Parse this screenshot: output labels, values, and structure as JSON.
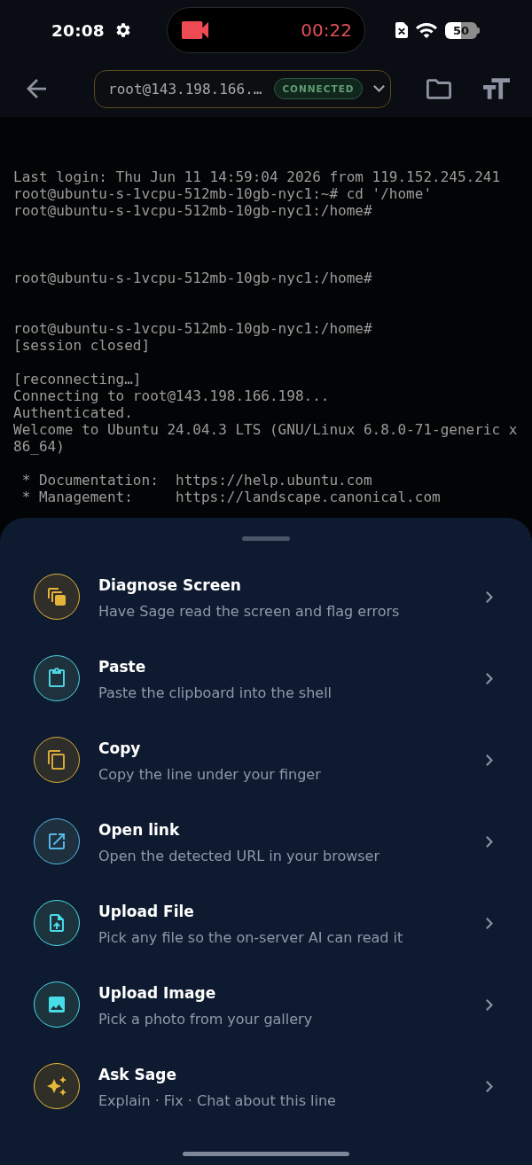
{
  "status_bar": {
    "time": "20:08",
    "recording_timer": "00:22",
    "battery": "50"
  },
  "header": {
    "host": "root@143.198.166.…",
    "status": "CONNECTED"
  },
  "terminal": {
    "lines": [
      {
        "kind": "text",
        "text": "Last login: Thu Jun 11 14:59:04 2026 from 119.152.245.241"
      },
      {
        "kind": "text",
        "text": "root@ubuntu-s-1vcpu-512mb-10gb-nyc1:~# cd '/home'"
      },
      {
        "kind": "text",
        "text": "root@ubuntu-s-1vcpu-512mb-10gb-nyc1:/home#"
      },
      {
        "kind": "blank"
      },
      {
        "kind": "blank"
      },
      {
        "kind": "blank"
      },
      {
        "kind": "text",
        "text": "root@ubuntu-s-1vcpu-512mb-10gb-nyc1:/home#"
      },
      {
        "kind": "blank"
      },
      {
        "kind": "blank"
      },
      {
        "kind": "text",
        "text": "root@ubuntu-s-1vcpu-512mb-10gb-nyc1:/home#"
      },
      {
        "kind": "text",
        "text": "[session closed]"
      },
      {
        "kind": "blank"
      },
      {
        "kind": "text",
        "text": "[reconnecting…]"
      },
      {
        "kind": "text",
        "text": "Connecting to root@143.198.166.198..."
      },
      {
        "kind": "text",
        "text": "Authenticated."
      },
      {
        "kind": "text",
        "text": "Welcome to Ubuntu 24.04.3 LTS (GNU/Linux 6.8.0-71-generic x"
      },
      {
        "kind": "text",
        "text": "86_64)"
      },
      {
        "kind": "blank"
      },
      {
        "kind": "text",
        "text": " * Documentation:  https://help.ubuntu.com"
      },
      {
        "kind": "text",
        "text": " * Management:     https://landscape.canonical.com"
      }
    ]
  },
  "sheet": {
    "items": [
      {
        "kind": "stack",
        "color": "#e6b43a",
        "title": "Diagnose Screen",
        "subtitle": "Have Sage read the screen and flag errors"
      },
      {
        "kind": "clipboard",
        "color": "#4fd4e4",
        "title": "Paste",
        "subtitle": "Paste the clipboard into the shell"
      },
      {
        "kind": "copy",
        "color": "#d9a93c",
        "title": "Copy",
        "subtitle": "Copy the line under your finger"
      },
      {
        "kind": "external",
        "color": "#56b8e8",
        "title": "Open link",
        "subtitle": "Open the detected URL in your browser"
      },
      {
        "kind": "upload",
        "color": "#48dbe8",
        "title": "Upload File",
        "subtitle": "Pick any file so the on-server AI can read it"
      },
      {
        "kind": "image",
        "color": "#48dbe8",
        "title": "Upload Image",
        "subtitle": "Pick a photo from your gallery"
      },
      {
        "kind": "sparkle",
        "color": "#e8b83a",
        "title": "Ask Sage",
        "subtitle": "Explain · Fix · Chat about this line"
      }
    ]
  }
}
